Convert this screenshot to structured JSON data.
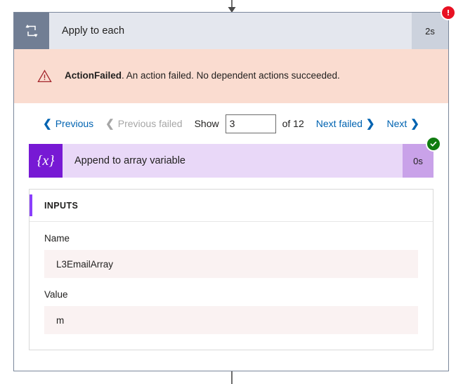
{
  "connectors": {
    "top_arrow_icon": "arrow-down-icon",
    "bottom_line_icon": "connector-line-icon"
  },
  "scope": {
    "icon": "loop-repeat-icon",
    "title": "Apply to each",
    "duration": "2s",
    "status": "failed",
    "status_badge_glyph": "!",
    "status_badge_color": "#e81123"
  },
  "error_banner": {
    "icon": "warning-triangle-icon",
    "code": "ActionFailed",
    "message": ". An action failed. No dependent actions succeeded.",
    "background_color": "#fadcd0"
  },
  "pager": {
    "previous_label": "Previous",
    "previous_chevron": "❮",
    "previous_failed_label": "Previous failed",
    "previous_failed_chevron": "❮",
    "show_label": "Show",
    "show_value": "3",
    "of_label": "of 12",
    "next_failed_label": "Next failed",
    "next_failed_chevron": "❯",
    "next_label": "Next",
    "next_chevron": "❯"
  },
  "action": {
    "icon": "variable-braces-icon",
    "icon_glyph": "{x}",
    "title": "Append to array variable",
    "duration": "0s",
    "status": "succeeded",
    "status_badge_glyph": "✓",
    "status_badge_color": "#107c10"
  },
  "inputs": {
    "section_title": "INPUTS",
    "accent_color": "#8a3ffc",
    "fields": [
      {
        "label": "Name",
        "value": "L3EmailArray"
      },
      {
        "label": "Value",
        "value": "m"
      }
    ]
  }
}
